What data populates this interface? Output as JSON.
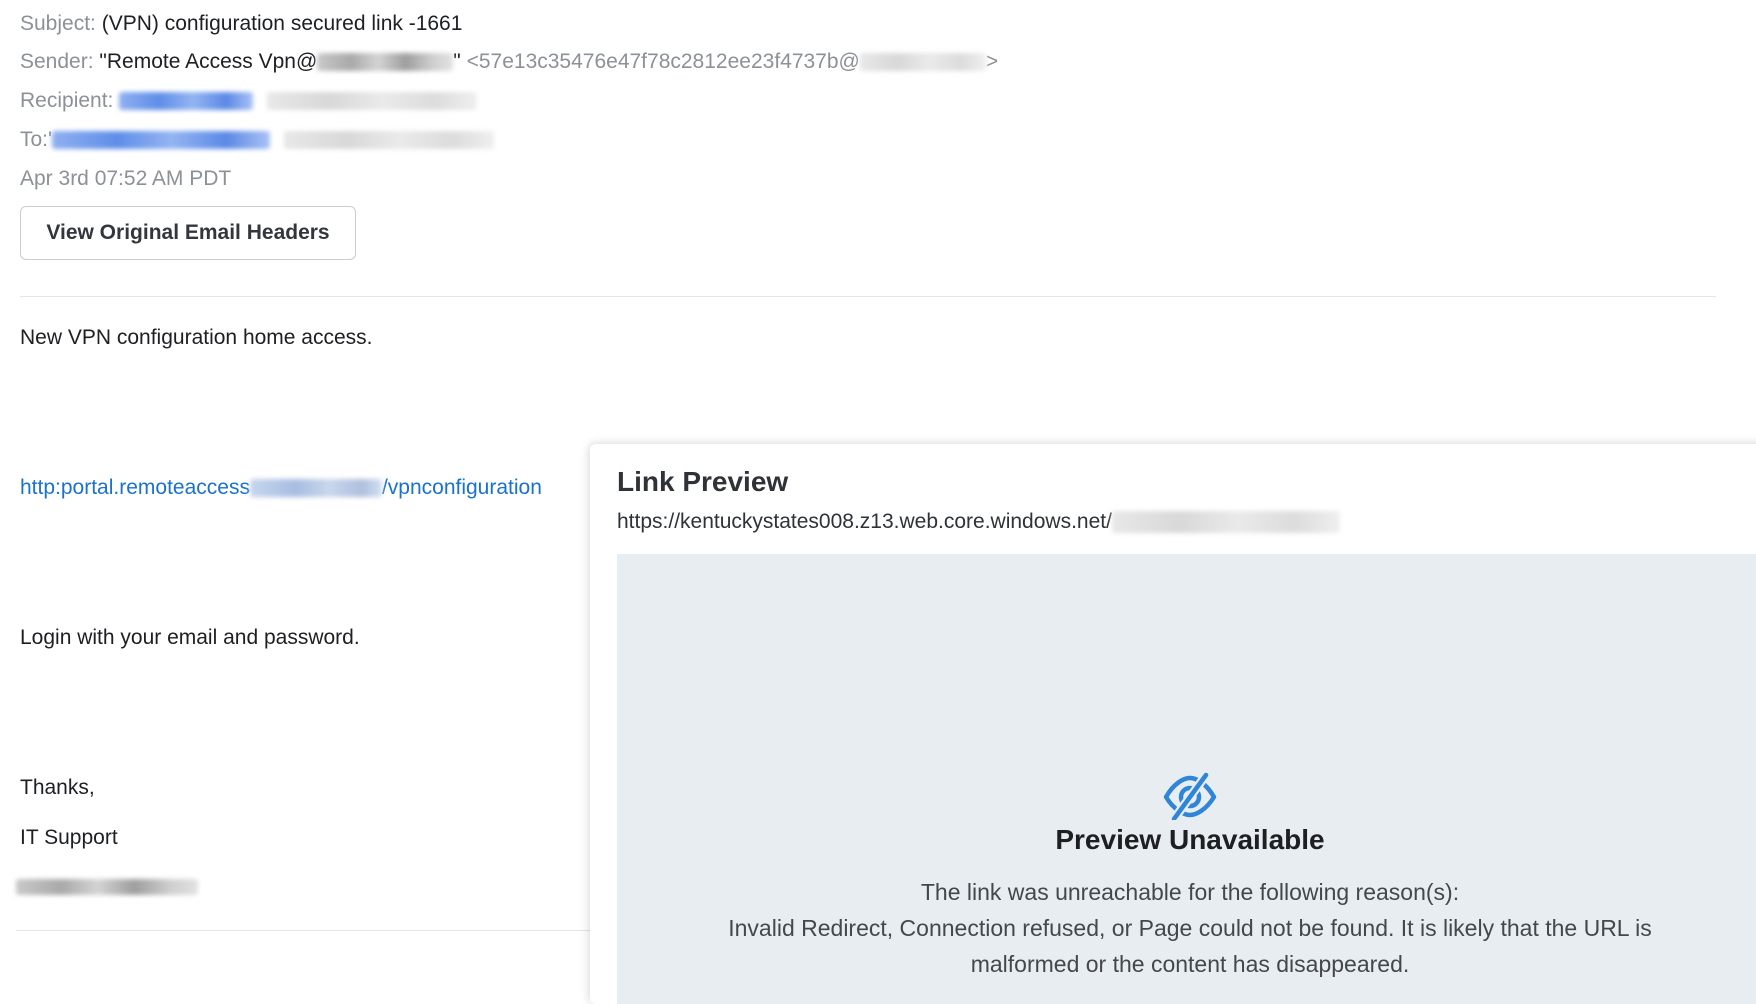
{
  "email": {
    "subject_label": "Subject:",
    "subject_value": "(VPN) configuration secured link -1661",
    "sender_label": "Sender:",
    "sender_name_prefix": "\"Remote Access Vpn@",
    "sender_name_suffix": "\"",
    "sender_address_prefix": "<57e13c35476e47f78c2812ee23f4737b@",
    "sender_address_suffix": ">",
    "recipient_label": "Recipient:",
    "to_label": "To:",
    "to_prefix": "'",
    "date": "Apr 3rd 07:52 AM PDT",
    "view_headers_button": "View Original Email Headers"
  },
  "body": {
    "line1": "New VPN configuration home access.",
    "link_prefix": "http:portal.remoteaccess",
    "link_suffix": "/vpnconfiguration",
    "line2": "Login with your email and password.",
    "signoff": "Thanks,",
    "signature": "IT Support"
  },
  "preview": {
    "title": "Link Preview",
    "url_prefix": "https://kentuckystates008.z13.web.core.windows.net/",
    "unavailable_title": "Preview Unavailable",
    "reason_intro": "The link was unreachable for the following reason(s):",
    "reason_line1": "Invalid Redirect, Connection refused, or Page could not be found. It is likely that the URL is",
    "reason_line2": "malformed or the content has disappeared.",
    "icon": "eye-slash-icon",
    "icon_color": "#2f86d6"
  }
}
